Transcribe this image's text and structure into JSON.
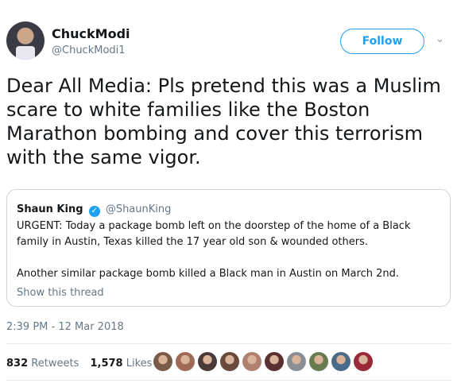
{
  "author": {
    "name": "ChuckModi",
    "handle": "@ChuckModi1",
    "avatar_icon": "user-avatar"
  },
  "follow_label": "Follow",
  "tweet_text": "Dear All Media: Pls pretend this was a Muslim scare to white families like the Boston Marathon bombing and cover this terrorism with the same vigor.",
  "quoted": {
    "name": "Shaun King",
    "handle": "@ShaunKing",
    "verified_icon": "verified-badge-icon",
    "paragraph1": "URGENT: Today a package bomb left on the doorstep of the home of a Black family in Austin, Texas killed the 17 year old son & wounded others.",
    "paragraph2": "Another similar package bomb killed a Black man in Austin on March 2nd.",
    "show_thread": "Show this thread"
  },
  "timestamp": "2:39 PM - 12 Mar 2018",
  "stats": {
    "retweets_count": "832",
    "retweets_label": "Retweets",
    "likes_count": "1,578",
    "likes_label": "Likes"
  },
  "liker_colors": [
    "#7a5a48",
    "#a06a58",
    "#4a3a3a",
    "#6a4a3a",
    "#b08070",
    "#5a3030",
    "#8a8f95",
    "#6a7a50",
    "#4a6a8a",
    "#9a2a3a"
  ],
  "colors": {
    "accent": "#1da1f2",
    "text": "#14171a",
    "muted": "#657786",
    "border": "#ccd6dd"
  }
}
